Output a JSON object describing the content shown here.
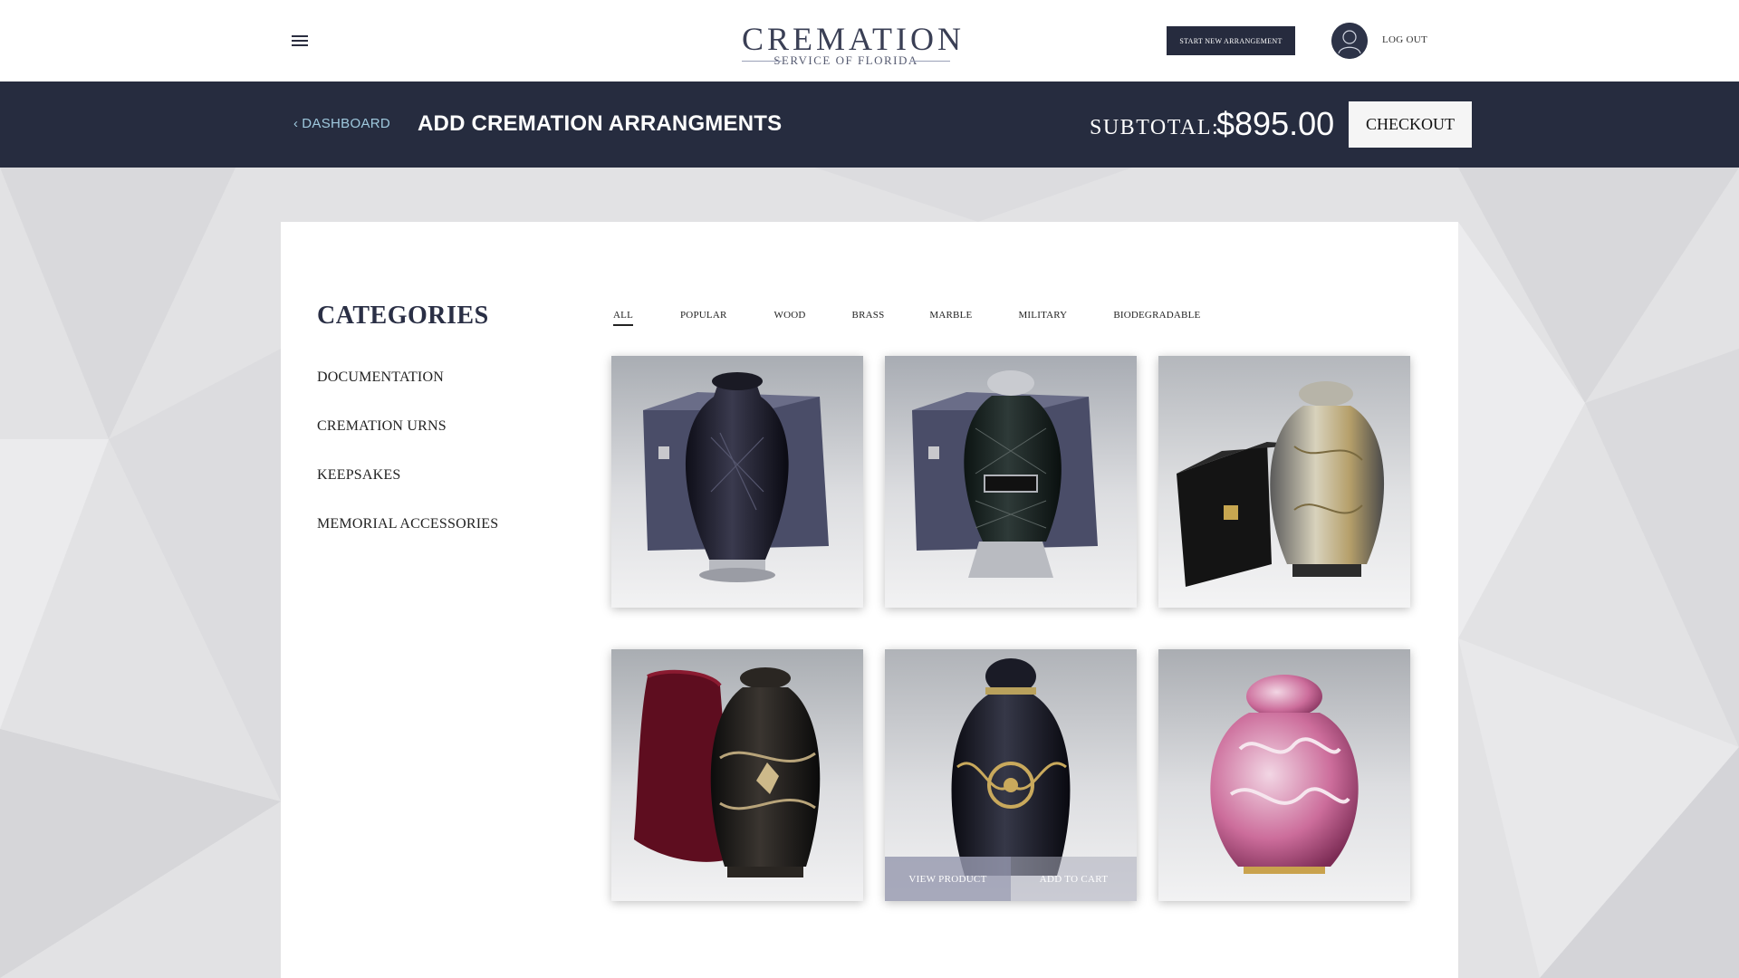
{
  "header": {
    "logo_main": "CREMATION",
    "logo_sub": "SERVICE OF FLORIDA",
    "start_button": "START NEW ARRANGEMENT",
    "logout": "LOG OUT"
  },
  "subheader": {
    "back_link": "DASHBOARD",
    "title": "ADD CREMATION ARRANGMENTS",
    "subtotal_label": "SUBTOTAL:",
    "subtotal_value": "$895.00",
    "checkout": "CHECKOUT"
  },
  "sidebar": {
    "title": "CATEGORIES",
    "items": [
      {
        "label": "DOCUMENTATION"
      },
      {
        "label": "CREMATION URNS"
      },
      {
        "label": "KEEPSAKES"
      },
      {
        "label": "MEMORIAL ACCESSORIES"
      }
    ]
  },
  "filters": [
    {
      "label": "ALL",
      "active": true
    },
    {
      "label": "POPULAR",
      "active": false
    },
    {
      "label": "WOOD",
      "active": false
    },
    {
      "label": "BRASS",
      "active": false
    },
    {
      "label": "MARBLE",
      "active": false
    },
    {
      "label": "MILITARY",
      "active": false
    },
    {
      "label": "BIODEGRADABLE",
      "active": false
    }
  ],
  "products": [
    {
      "image": "black-crystal-cut-urn-with-box"
    },
    {
      "image": "dark-diamond-urn-with-nameplate-and-box"
    },
    {
      "image": "silver-gold-floral-engraved-urn-with-black-box"
    },
    {
      "image": "black-gold-leaf-urn-with-red-velvet-bag"
    },
    {
      "image": "black-gold-flower-urn",
      "hover": true
    },
    {
      "image": "pink-cloisonne-floral-urn"
    }
  ],
  "product_overlay": {
    "view": "VIEW PRODUCT",
    "add": "ADD TO CART"
  },
  "colors": {
    "header_dark": "#262c3f",
    "accent_link": "#9fc9de",
    "page_bg": "#e4e4e5"
  }
}
